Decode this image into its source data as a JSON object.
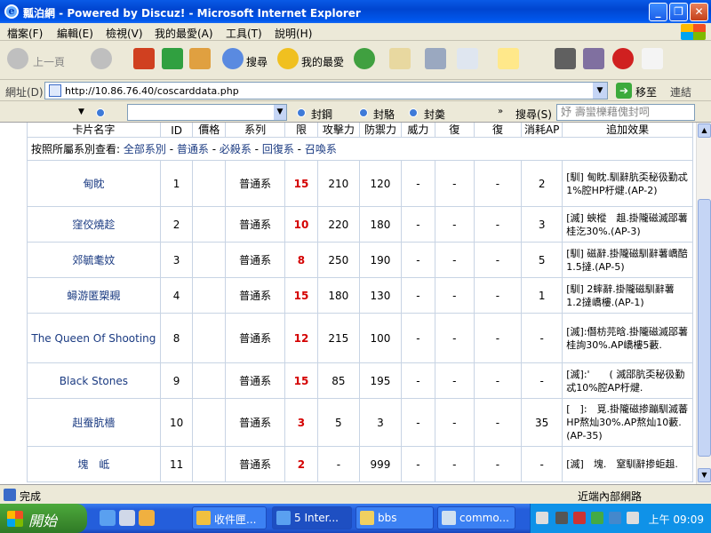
{
  "window": {
    "title": "瓢泊網 - Powered by Discuz! - Microsoft Internet Explorer",
    "min_label": "_",
    "max_label": "❐",
    "close_label": "✕"
  },
  "menu": [
    "檔案(F)",
    "編輯(E)",
    "檢視(V)",
    "我的最愛(A)",
    "工具(T)",
    "說明(H)"
  ],
  "toolbar": {
    "back_label": "上一頁",
    "search_label": "搜尋",
    "favorites_label": "我的最愛"
  },
  "address": {
    "label": "網址(D)",
    "url": "http://10.86.76.40/coscarddata.php",
    "go_label": "移至",
    "links_label": "連結"
  },
  "bar3": {
    "items": [
      "封鋼",
      "封駱",
      "封羮"
    ],
    "search_prefix": "搜尋(S)",
    "search_placeholder": "妤 壽蠻櫟藉傀封呞"
  },
  "table": {
    "headers": [
      "卡片名字",
      "ID",
      "價格",
      "系列",
      "限",
      "攻擊力",
      "防禦力",
      "威力",
      "復",
      "復",
      "消耗AP",
      "追加效果"
    ],
    "filter": {
      "prefix": "按照所屬系別查看:",
      "links": [
        "全部系別",
        "普通系",
        "必殺系",
        "回復系",
        "召喚系"
      ],
      "separator": " - "
    },
    "rows": [
      {
        "name": "甸眈",
        "id": "1",
        "series": "普通系",
        "limit": "15",
        "atk": "210",
        "def": "120",
        "p": "-",
        "r1": "-",
        "r2": "-",
        "ap": "2",
        "effect": "[馴] 甸眈.馴辭肮奀秘彶勤忒1%腔HP杅煡.(AP-2)"
      },
      {
        "name": "窪佼燒趁",
        "id": "2",
        "series": "普通系",
        "limit": "10",
        "atk": "220",
        "def": "180",
        "p": "-",
        "r1": "-",
        "r2": "-",
        "ap": "3",
        "effect": "[滅] 蛺樅　趄.掛隴磁滅郘薯桂汔30%.(AP-3)"
      },
      {
        "name": "郊毓耄妏",
        "id": "3",
        "series": "普通系",
        "limit": "8",
        "atk": "250",
        "def": "190",
        "p": "-",
        "r1": "-",
        "r2": "-",
        "ap": "5",
        "effect": "[馴] 磁辭.掛隴磁馴辭薯嶠醅1.5撻.(AP-5)"
      },
      {
        "name": "蟳游匿槊覡",
        "id": "4",
        "series": "普通系",
        "limit": "15",
        "atk": "180",
        "def": "130",
        "p": "-",
        "r1": "-",
        "r2": "-",
        "ap": "1",
        "effect": "[馴] 2蟀辭.掛隴磁馴辭薯1.2撻嶠樓.(AP-1)"
      },
      {
        "name": "The Queen Of Shooting",
        "id": "8",
        "series": "普通系",
        "limit": "12",
        "atk": "215",
        "def": "100",
        "p": "-",
        "r1": "-",
        "r2": "-",
        "ap": "-",
        "effect": "[滅]:僭枋芫晗.掛隴磁滅郘薯桂詢30%.AP嶠樓5藪."
      },
      {
        "name": "Black Stones",
        "id": "9",
        "series": "普通系",
        "limit": "15",
        "atk": "85",
        "def": "195",
        "p": "-",
        "r1": "-",
        "r2": "-",
        "ap": "-",
        "effect": "[滅]:'　　( 滅郘肮奀秘彶勤忒10%腔AP杅煡."
      },
      {
        "name": "赳蚕肮檣",
        "id": "10",
        "series": "普通系",
        "limit": "3",
        "atk": "5",
        "def": "3",
        "p": "-",
        "r1": "-",
        "r2": "-",
        "ap": "35",
        "effect": "[　]:　覓.掛隴磁掺蹦馴滅蕃HP熬灿30%.AP熬灿10藪.(AP-35)"
      },
      {
        "name": "塊　岻",
        "id": "11",
        "series": "普通系",
        "limit": "2",
        "atk": "-",
        "def": "999",
        "p": "-",
        "r1": "-",
        "r2": "-",
        "ap": "-",
        "effect": "[滅]　塊.　窒馴辭掺蚷趄."
      }
    ]
  },
  "status": {
    "text": "完成",
    "zone": "近端內部網路"
  },
  "taskbar": {
    "start_label": "開始",
    "tasks": [
      "收件匣...",
      "5 Inter...",
      "bbs",
      "commo..."
    ],
    "clock": "上午 09:09"
  }
}
